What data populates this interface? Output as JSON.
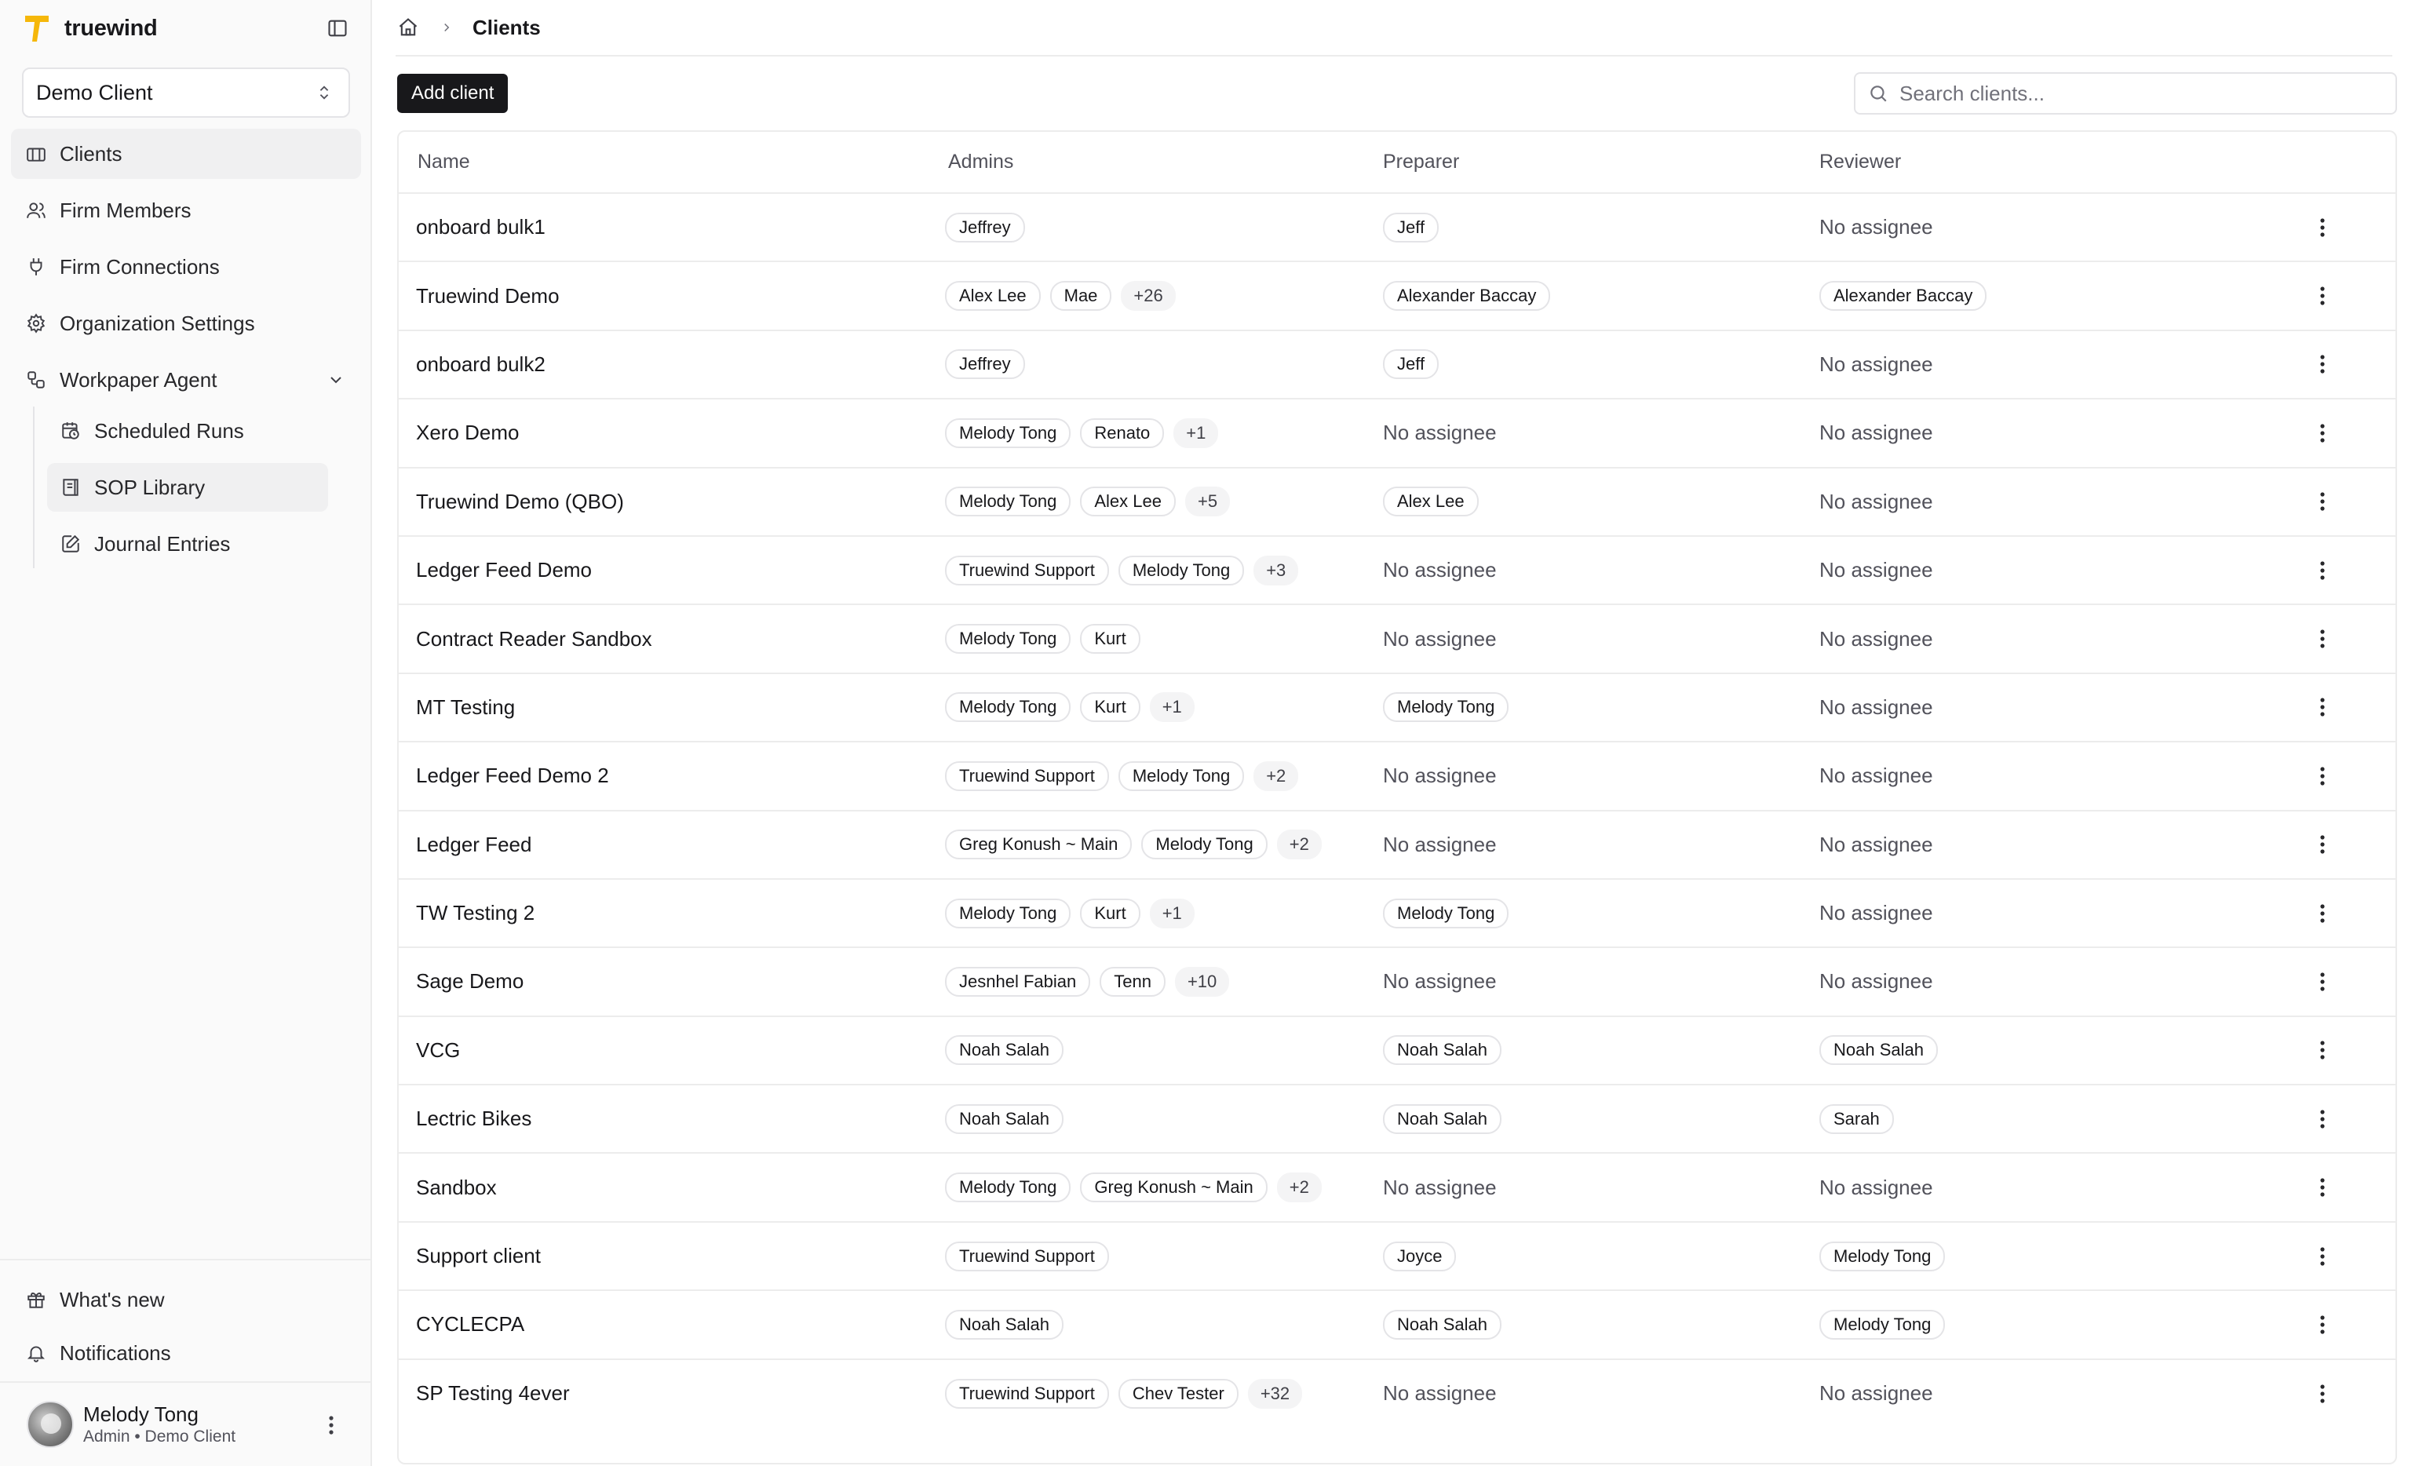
{
  "brand": {
    "name": "truewind",
    "accent": "#f5b70a"
  },
  "client_select": {
    "value": "Demo Client"
  },
  "nav": {
    "items": [
      {
        "label": "Clients",
        "icon": "building-icon",
        "active": true
      },
      {
        "label": "Firm Members",
        "icon": "users-icon"
      },
      {
        "label": "Firm Connections",
        "icon": "plug-icon"
      },
      {
        "label": "Organization Settings",
        "icon": "gear-icon"
      },
      {
        "label": "Workpaper Agent",
        "icon": "workflow-icon"
      }
    ],
    "sub_items": [
      {
        "label": "Scheduled Runs",
        "icon": "calendar-clock-icon"
      },
      {
        "label": "SOP Library",
        "icon": "book-icon",
        "active": true
      },
      {
        "label": "Journal Entries",
        "icon": "edit-icon"
      }
    ]
  },
  "bottom_nav": {
    "whats_new": "What's new",
    "notifications": "Notifications"
  },
  "user": {
    "name": "Melody Tong",
    "role": "Admin • Demo Client"
  },
  "breadcrumb": {
    "current": "Clients"
  },
  "toolbar": {
    "add_label": "Add client"
  },
  "search": {
    "placeholder": "Search clients..."
  },
  "table": {
    "columns": [
      "Name",
      "Admins",
      "Preparer",
      "Reviewer"
    ],
    "no_assignee": "No assignee",
    "rows": [
      {
        "name": "onboard bulk1",
        "admins": [
          "Jeffrey"
        ],
        "more": "",
        "preparer": "Jeff",
        "reviewer": ""
      },
      {
        "name": "Truewind Demo",
        "admins": [
          "Alex Lee",
          "Mae"
        ],
        "more": "+26",
        "preparer": "Alexander Baccay",
        "reviewer": "Alexander Baccay"
      },
      {
        "name": "onboard bulk2",
        "admins": [
          "Jeffrey"
        ],
        "more": "",
        "preparer": "Jeff",
        "reviewer": ""
      },
      {
        "name": "Xero Demo",
        "admins": [
          "Melody Tong",
          "Renato"
        ],
        "more": "+1",
        "preparer": "",
        "reviewer": ""
      },
      {
        "name": "Truewind Demo (QBO)",
        "admins": [
          "Melody Tong",
          "Alex Lee"
        ],
        "more": "+5",
        "preparer": "Alex Lee",
        "reviewer": ""
      },
      {
        "name": "Ledger Feed Demo",
        "admins": [
          "Truewind Support",
          "Melody Tong"
        ],
        "more": "+3",
        "preparer": "",
        "reviewer": ""
      },
      {
        "name": "Contract Reader Sandbox",
        "admins": [
          "Melody Tong",
          "Kurt"
        ],
        "more": "",
        "preparer": "",
        "reviewer": ""
      },
      {
        "name": "MT Testing",
        "admins": [
          "Melody Tong",
          "Kurt"
        ],
        "more": "+1",
        "preparer": "Melody Tong",
        "reviewer": ""
      },
      {
        "name": "Ledger Feed Demo 2",
        "admins": [
          "Truewind Support",
          "Melody Tong"
        ],
        "more": "+2",
        "preparer": "",
        "reviewer": ""
      },
      {
        "name": "Ledger Feed",
        "admins": [
          "Greg Konush ~ Main",
          "Melody Tong"
        ],
        "more": "+2",
        "preparer": "",
        "reviewer": ""
      },
      {
        "name": "TW Testing 2",
        "admins": [
          "Melody Tong",
          "Kurt"
        ],
        "more": "+1",
        "preparer": "Melody Tong",
        "reviewer": ""
      },
      {
        "name": "Sage Demo",
        "admins": [
          "Jesnhel Fabian",
          "Tenn"
        ],
        "more": "+10",
        "preparer": "",
        "reviewer": ""
      },
      {
        "name": "VCG",
        "admins": [
          "Noah Salah"
        ],
        "more": "",
        "preparer": "Noah Salah",
        "reviewer": "Noah Salah"
      },
      {
        "name": "Lectric Bikes",
        "admins": [
          "Noah Salah"
        ],
        "more": "",
        "preparer": "Noah Salah",
        "reviewer": "Sarah"
      },
      {
        "name": "Sandbox",
        "admins": [
          "Melody Tong",
          "Greg Konush ~ Main"
        ],
        "more": "+2",
        "preparer": "",
        "reviewer": ""
      },
      {
        "name": "Support client",
        "admins": [
          "Truewind Support"
        ],
        "more": "",
        "preparer": "Joyce",
        "reviewer": "Melody Tong"
      },
      {
        "name": "CYCLECPA",
        "admins": [
          "Noah Salah"
        ],
        "more": "",
        "preparer": "Noah Salah",
        "reviewer": "Melody Tong"
      },
      {
        "name": "SP Testing 4ever",
        "admins": [
          "Truewind Support",
          "Chev Tester"
        ],
        "more": "+32",
        "preparer": "",
        "reviewer": ""
      }
    ]
  }
}
